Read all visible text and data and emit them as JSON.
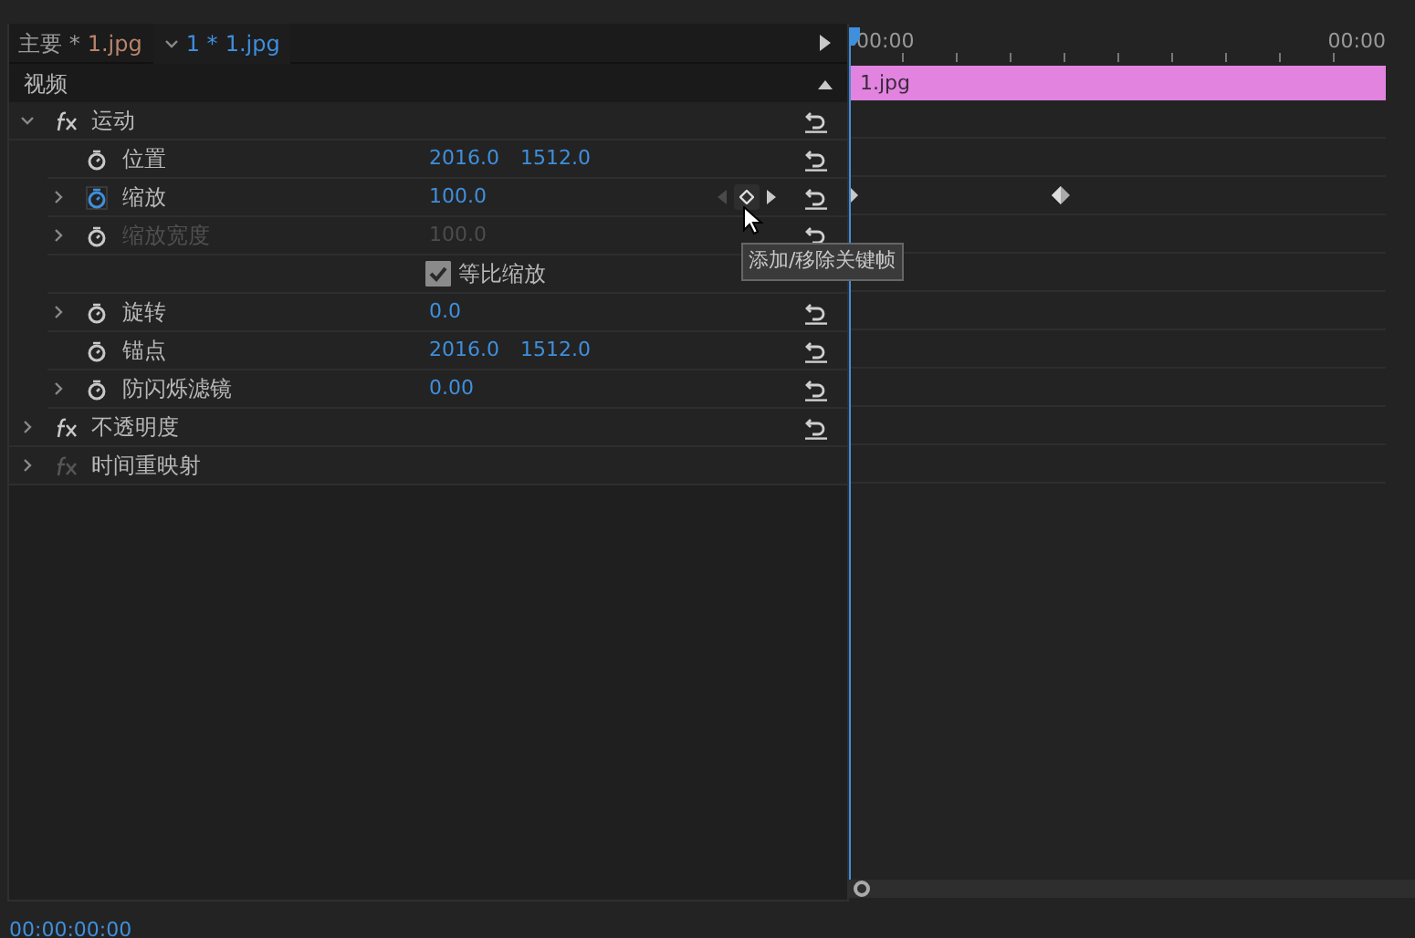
{
  "tabs": [
    {
      "sequence": "主要 *",
      "clip": "1.jpg",
      "selected": false
    },
    {
      "sequence": "1 *",
      "clip": "1.jpg",
      "selected": true
    }
  ],
  "section": {
    "label": "视频",
    "expanded": true
  },
  "effects": [
    {
      "name": "运动",
      "expanded": true,
      "enabled": true,
      "reset": true,
      "properties": [
        {
          "kind": "property",
          "name": "位置",
          "values": [
            "2016.0",
            "1512.0"
          ],
          "expandable": false,
          "animating": false,
          "disabled": false,
          "reset": true,
          "keyframes": false
        },
        {
          "kind": "property",
          "name": "缩放",
          "values": [
            "100.0"
          ],
          "expandable": true,
          "animating": true,
          "disabled": false,
          "reset": true,
          "keyframes": true
        },
        {
          "kind": "property",
          "name": "缩放宽度",
          "values": [
            "100.0"
          ],
          "expandable": true,
          "animating": false,
          "disabled": true,
          "reset": true,
          "keyframes": false
        },
        {
          "kind": "checkbox",
          "name": "等比缩放",
          "checked": true
        },
        {
          "kind": "property",
          "name": "旋转",
          "values": [
            "0.0"
          ],
          "expandable": true,
          "animating": false,
          "disabled": false,
          "reset": true,
          "keyframes": false
        },
        {
          "kind": "property",
          "name": "锚点",
          "values": [
            "2016.0",
            "1512.0"
          ],
          "expandable": false,
          "animating": false,
          "disabled": false,
          "reset": true,
          "keyframes": false
        },
        {
          "kind": "property",
          "name": "防闪烁滤镜",
          "values": [
            "0.00"
          ],
          "expandable": true,
          "animating": false,
          "disabled": false,
          "reset": true,
          "keyframes": false
        }
      ]
    },
    {
      "name": "不透明度",
      "expanded": false,
      "enabled": true,
      "reset": true
    },
    {
      "name": "时间重映射",
      "expanded": false,
      "enabled": false,
      "reset": false
    }
  ],
  "tooltip": "添加/移除关键帧",
  "timeline": {
    "start": "00:00",
    "end": "00:00",
    "clip": "1.jpg"
  },
  "timecode": "00:00:00:00"
}
